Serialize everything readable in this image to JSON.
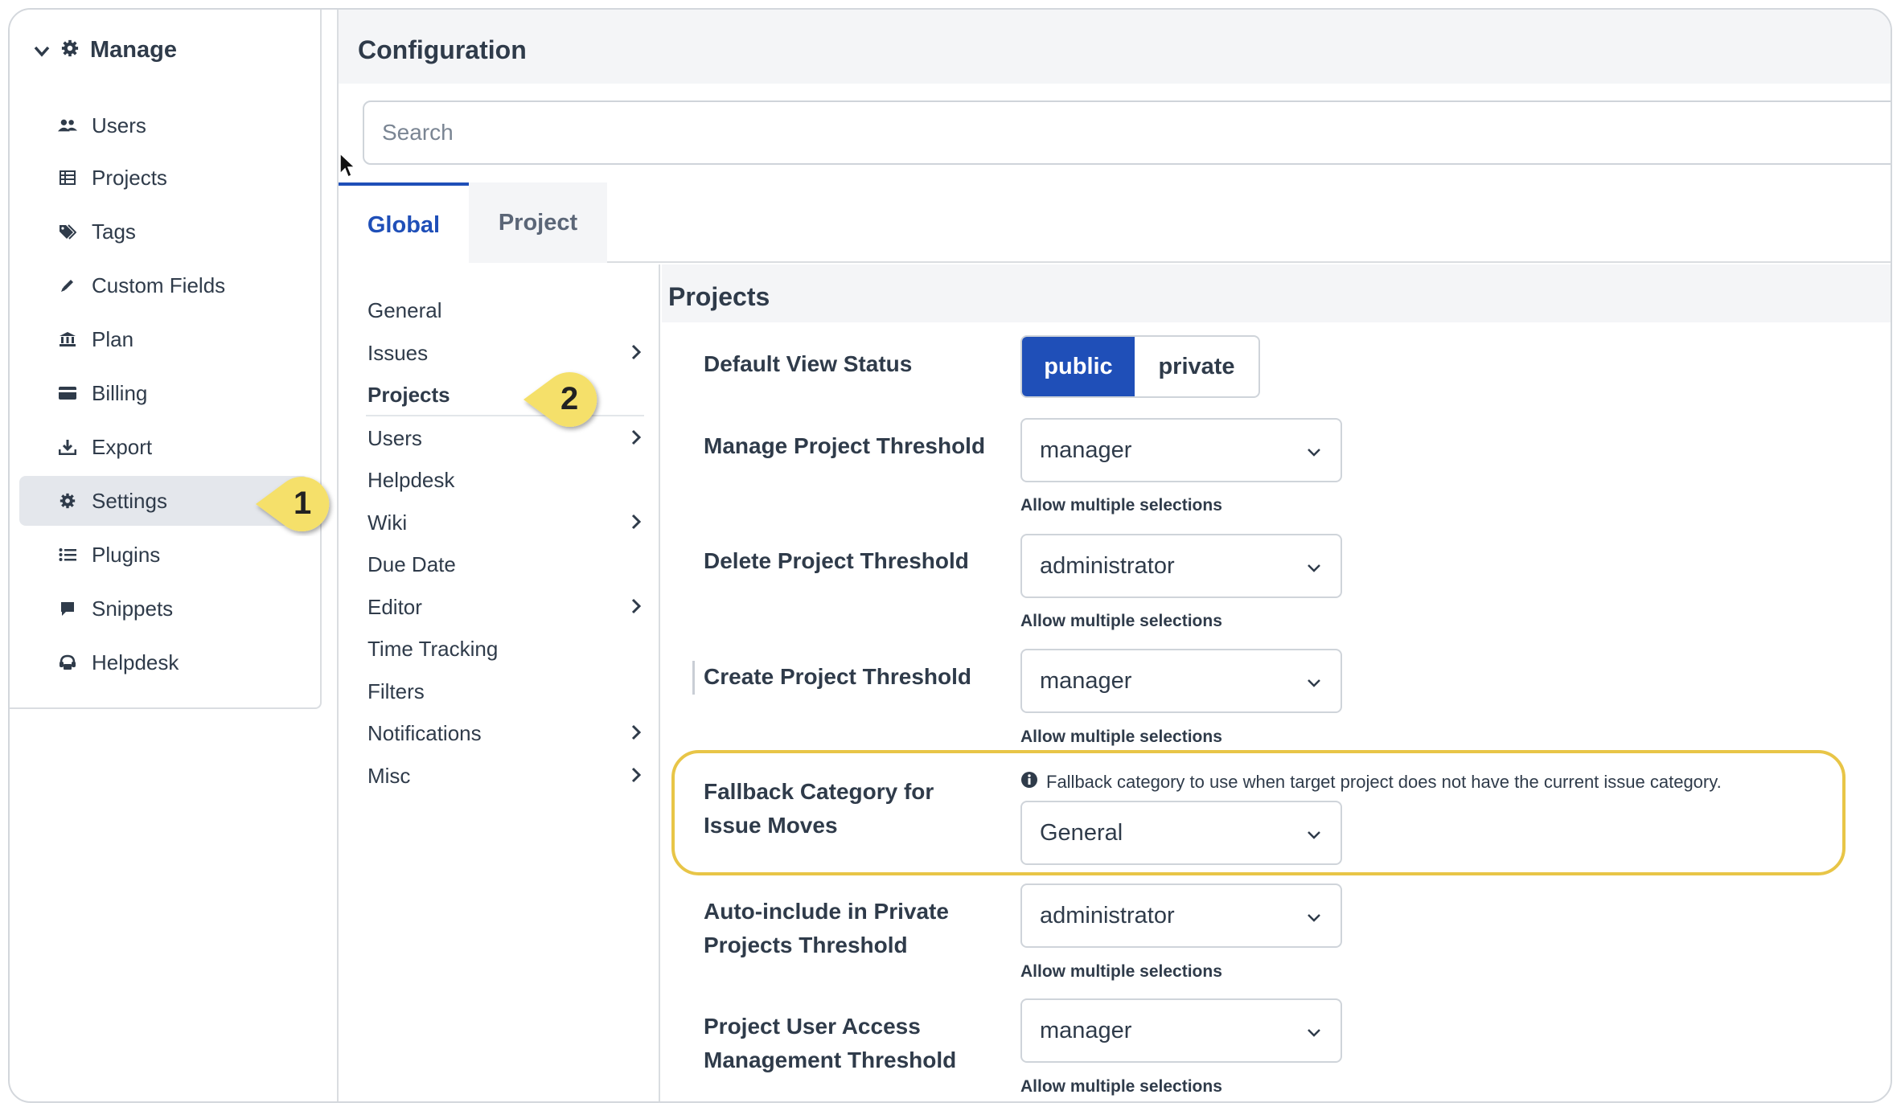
{
  "sidebar": {
    "header": "Manage",
    "items": [
      {
        "label": "Users",
        "icon": "users-icon"
      },
      {
        "label": "Projects",
        "icon": "table-icon"
      },
      {
        "label": "Tags",
        "icon": "tags-icon"
      },
      {
        "label": "Custom Fields",
        "icon": "pencil-icon"
      },
      {
        "label": "Plan",
        "icon": "bank-icon"
      },
      {
        "label": "Billing",
        "icon": "credit-card-icon"
      },
      {
        "label": "Export",
        "icon": "download-icon"
      },
      {
        "label": "Settings",
        "icon": "gear-icon",
        "active": true
      },
      {
        "label": "Plugins",
        "icon": "list-icon"
      },
      {
        "label": "Snippets",
        "icon": "comment-icon"
      },
      {
        "label": "Helpdesk",
        "icon": "helpdesk-icon"
      }
    ]
  },
  "main": {
    "title": "Configuration",
    "search_placeholder": "Search",
    "tabs": [
      {
        "label": "Global",
        "active": true
      },
      {
        "label": "Project"
      }
    ],
    "subnav": [
      {
        "label": "General",
        "chevron": false
      },
      {
        "label": "Issues",
        "chevron": true
      },
      {
        "label": "Projects",
        "chevron": false,
        "active": true
      },
      {
        "label": "Users",
        "chevron": true
      },
      {
        "label": "Helpdesk",
        "chevron": false
      },
      {
        "label": "Wiki",
        "chevron": true
      },
      {
        "label": "Due Date",
        "chevron": false
      },
      {
        "label": "Editor",
        "chevron": true
      },
      {
        "label": "Time Tracking",
        "chevron": false
      },
      {
        "label": "Filters",
        "chevron": false
      },
      {
        "label": "Notifications",
        "chevron": true
      },
      {
        "label": "Misc",
        "chevron": true
      }
    ],
    "section_title": "Projects",
    "settings": {
      "default_view": {
        "label": "Default View Status",
        "options": [
          "public",
          "private"
        ],
        "selected": "public"
      },
      "manage_threshold": {
        "label": "Manage Project Threshold",
        "value": "manager",
        "hint": "Allow multiple selections"
      },
      "delete_threshold": {
        "label": "Delete Project Threshold",
        "value": "administrator",
        "hint": "Allow multiple selections"
      },
      "create_threshold": {
        "label": "Create Project Threshold",
        "value": "manager",
        "hint": "Allow multiple selections"
      },
      "fallback_category": {
        "label_line1": "Fallback Category for",
        "label_line2": "Issue Moves",
        "info": "Fallback category to use when target project does not have the current issue category.",
        "value": "General"
      },
      "auto_include": {
        "label_line1": "Auto-include in Private",
        "label_line2": "Projects Threshold",
        "value": "administrator",
        "hint": "Allow multiple selections"
      },
      "user_access": {
        "label_line1": "Project User Access",
        "label_line2": "Management Threshold",
        "value": "manager",
        "hint": "Allow multiple selections"
      }
    }
  },
  "callouts": {
    "one": "1",
    "two": "2"
  },
  "colors": {
    "accent": "#1f4fb8",
    "highlight": "#e8c547",
    "callout": "#f5e06a"
  }
}
